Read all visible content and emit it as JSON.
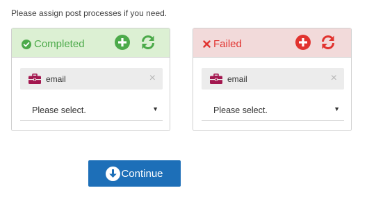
{
  "instruction": "Please assign post processes if you need.",
  "colors": {
    "success": "#4caa4a",
    "danger": "#e1332f",
    "primary": "#1d6fb8",
    "briefcase": "#a3174f"
  },
  "panels": [
    {
      "status_label": "Completed",
      "status_icon": "check-circle-icon",
      "add_icon": "plus-circle-icon",
      "refresh_icon": "refresh-icon",
      "chip": {
        "icon": "briefcase-icon",
        "label": "email",
        "remove": "×"
      },
      "select": {
        "value": "Please select.",
        "caret": "▼"
      }
    },
    {
      "status_label": "Failed",
      "status_icon": "x-icon",
      "add_icon": "plus-circle-icon",
      "refresh_icon": "refresh-icon",
      "chip": {
        "icon": "briefcase-icon",
        "label": "email",
        "remove": "×"
      },
      "select": {
        "value": "Please select.",
        "caret": "▼"
      }
    }
  ],
  "continue_button": {
    "label": "Continue",
    "icon": "arrow-down-circle-icon"
  }
}
